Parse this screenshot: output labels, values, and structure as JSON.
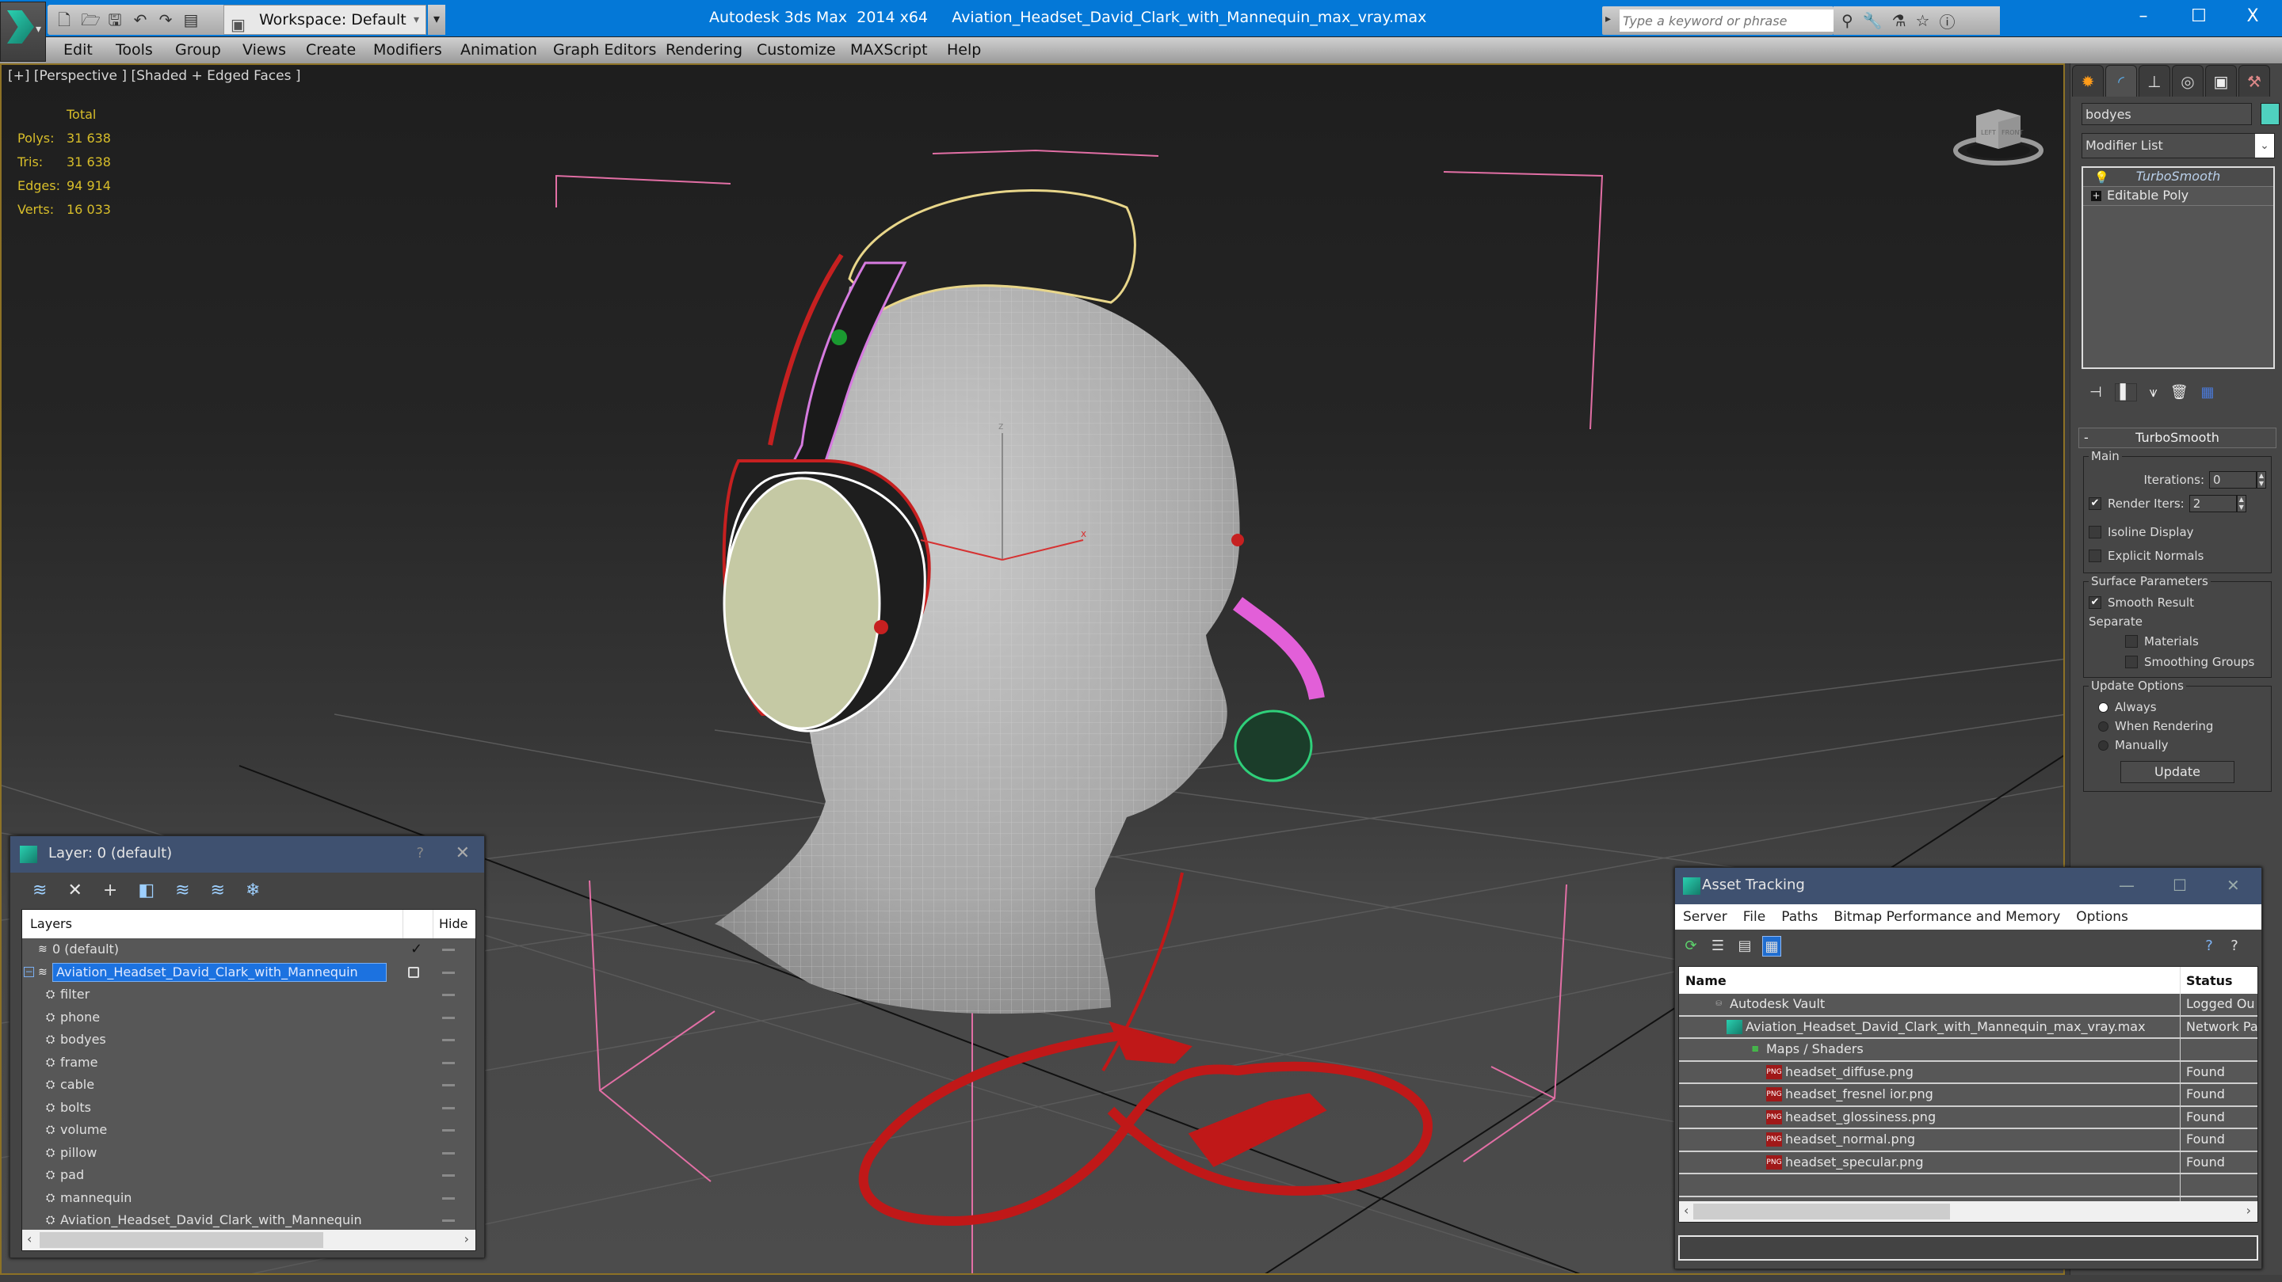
{
  "titlebar": {
    "app_title": "Autodesk 3ds Max  2014 x64",
    "file_name": "Aviation_Headset_David_Clark_with_Mannequin_max_vray.max",
    "workspace": "Workspace: Default",
    "search_placeholder": "Type a keyword or phrase",
    "minimize": "–",
    "maximize": "☐",
    "close": "X"
  },
  "menu": [
    "Edit",
    "Tools",
    "Group",
    "Views",
    "Create",
    "Modifiers",
    "Animation",
    "Graph Editors",
    "Rendering",
    "Customize",
    "MAXScript",
    "Help"
  ],
  "viewport": {
    "label": "[+] [Perspective ] [Shaded + Edged Faces ]",
    "stats_header": "Total",
    "stats": [
      {
        "label": "Polys:",
        "value": "31 638"
      },
      {
        "label": "Tris:",
        "value": "31 638"
      },
      {
        "label": "Edges:",
        "value": "94 914"
      },
      {
        "label": "Verts:",
        "value": "16 033"
      }
    ],
    "viewcube": {
      "left": "LEFT",
      "front": "FRONT"
    }
  },
  "command_panel": {
    "object_name": "bodyes",
    "object_color": "#4fd1bf",
    "modifier_list_label": "Modifier List",
    "stack": [
      {
        "label": "TurboSmooth",
        "selected": true
      },
      {
        "label": "Editable Poly",
        "selected": false
      }
    ],
    "rollout": {
      "title": "TurboSmooth",
      "main_label": "Main",
      "iterations_label": "Iterations:",
      "iterations_value": "0",
      "render_iters_label": "Render Iters:",
      "render_iters_value": "2",
      "render_iters_checked": true,
      "isoline_label": "Isoline Display",
      "explicit_normals_label": "Explicit Normals",
      "surface_label": "Surface Parameters",
      "smooth_result_label": "Smooth Result",
      "separate_label": "Separate",
      "materials_label": "Materials",
      "smoothing_groups_label": "Smoothing Groups",
      "update_options_label": "Update Options",
      "always_label": "Always",
      "when_rendering_label": "When Rendering",
      "manually_label": "Manually",
      "update_button": "Update",
      "selected_update_option": "Always"
    }
  },
  "layer_explorer": {
    "title": "Layer: 0 (default)",
    "help": "?",
    "close": "✕",
    "col_layers": "Layers",
    "col_hide": "Hide",
    "rows": [
      {
        "name": "0 (default)",
        "type": "layer",
        "level": 0,
        "current": true
      },
      {
        "name": "Aviation_Headset_David_Clark_with_Mannequin",
        "type": "layer",
        "level": 0,
        "selected": true
      },
      {
        "name": "filter",
        "type": "object",
        "level": 1
      },
      {
        "name": "phone",
        "type": "object",
        "level": 1
      },
      {
        "name": "bodyes",
        "type": "object",
        "level": 1
      },
      {
        "name": "frame",
        "type": "object",
        "level": 1
      },
      {
        "name": "cable",
        "type": "object",
        "level": 1
      },
      {
        "name": "bolts",
        "type": "object",
        "level": 1
      },
      {
        "name": "volume",
        "type": "object",
        "level": 1
      },
      {
        "name": "pillow",
        "type": "object",
        "level": 1
      },
      {
        "name": "pad",
        "type": "object",
        "level": 1
      },
      {
        "name": "mannequin",
        "type": "object",
        "level": 1
      },
      {
        "name": "Aviation_Headset_David_Clark_with_Mannequin",
        "type": "object",
        "level": 1
      }
    ]
  },
  "asset_tracking": {
    "title": "Asset Tracking",
    "menu": [
      "Server",
      "File",
      "Paths",
      "Bitmap Performance and Memory",
      "Options"
    ],
    "col_name": "Name",
    "col_status": "Status",
    "rows": [
      {
        "name": "Autodesk Vault",
        "status": "Logged Ou",
        "level": 1,
        "icon": "vault"
      },
      {
        "name": "Aviation_Headset_David_Clark_with_Mannequin_max_vray.max",
        "status": "Network Pa",
        "level": 2,
        "icon": "max"
      },
      {
        "name": "Maps / Shaders",
        "status": "",
        "level": 3,
        "icon": "maps"
      },
      {
        "name": "headset_diffuse.png",
        "status": "Found",
        "level": 4,
        "icon": "png"
      },
      {
        "name": "headset_fresnel ior.png",
        "status": "Found",
        "level": 4,
        "icon": "png"
      },
      {
        "name": "headset_glossiness.png",
        "status": "Found",
        "level": 4,
        "icon": "png"
      },
      {
        "name": "headset_normal.png",
        "status": "Found",
        "level": 4,
        "icon": "png"
      },
      {
        "name": "headset_specular.png",
        "status": "Found",
        "level": 4,
        "icon": "png"
      }
    ]
  }
}
